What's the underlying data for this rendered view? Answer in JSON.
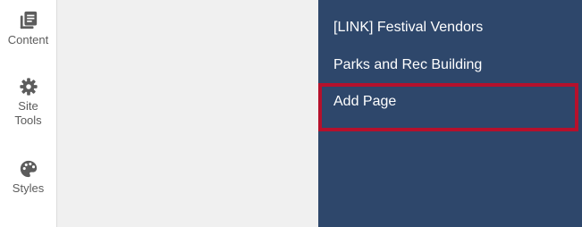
{
  "sidebar": {
    "tools": [
      {
        "label": "Content",
        "icon": "content-pages-icon"
      },
      {
        "label": "Site\nTools",
        "icon": "gear-icon"
      },
      {
        "label": "Styles",
        "icon": "palette-icon"
      }
    ]
  },
  "navigation": {
    "background": "#2e476b",
    "items": [
      {
        "label": "[LINK] Festival Vendors"
      },
      {
        "label": "Parks and Rec Building"
      },
      {
        "label": "Add Page"
      }
    ],
    "highlight_color": "#b5112c"
  }
}
